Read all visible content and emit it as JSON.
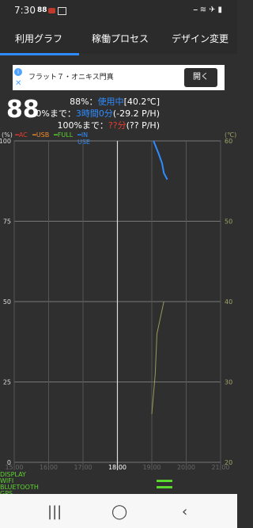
{
  "status": {
    "time": "7:30",
    "badge": "88"
  },
  "tabs": [
    {
      "label": "利用グラフ"
    },
    {
      "label": "稼働プロセス"
    },
    {
      "label": "デザイン変更"
    }
  ],
  "ad": {
    "text": "フラット７・オニキス門真",
    "button": "開く"
  },
  "battery": {
    "percent": "88",
    "status_line_label": "88%：",
    "status_line_value": "使用中",
    "status_line_temp": "[40.2℃]",
    "to0_label": "0%まで：",
    "to0_time": "3時間0分",
    "to0_rate": "(-29.2 P/H)",
    "to100_label": "100%まで：",
    "to100_time": "??分",
    "to100_rate": "(?? P/H)"
  },
  "legend": {
    "unitL": "(%)",
    "unitR": "(℃)",
    "ac": "━AC",
    "usb": "━USB",
    "full": "━FULL",
    "inuse": "━IN USE"
  },
  "chart_data": {
    "type": "line",
    "x": [
      "15:00",
      "16:00",
      "17:00",
      "18:00",
      "19:00",
      "20:00",
      "21:00"
    ],
    "y_left_ticks": [
      100,
      75,
      50,
      25,
      0
    ],
    "y_right_ticks": [
      60,
      50,
      40,
      30,
      20
    ],
    "series": [
      {
        "name": "IN USE",
        "color": "#2f8cff",
        "points": [
          {
            "x": 19.05,
            "y": 100
          },
          {
            "x": 19.2,
            "y": 96
          },
          {
            "x": 19.3,
            "y": 93
          },
          {
            "x": 19.35,
            "y": 90
          },
          {
            "x": 19.45,
            "y": 88
          }
        ]
      },
      {
        "name": "temperature",
        "color": "#9a9a5a",
        "points": [
          {
            "x": 19.0,
            "y": 26
          },
          {
            "x": 19.1,
            "y": 31
          },
          {
            "x": 19.15,
            "y": 36
          },
          {
            "x": 19.25,
            "y": 38
          },
          {
            "x": 19.35,
            "y": 40
          }
        ]
      }
    ]
  },
  "bottom_labels": [
    "DISPLAY",
    "WIFI",
    "BLUETOOTH",
    "GPS"
  ]
}
